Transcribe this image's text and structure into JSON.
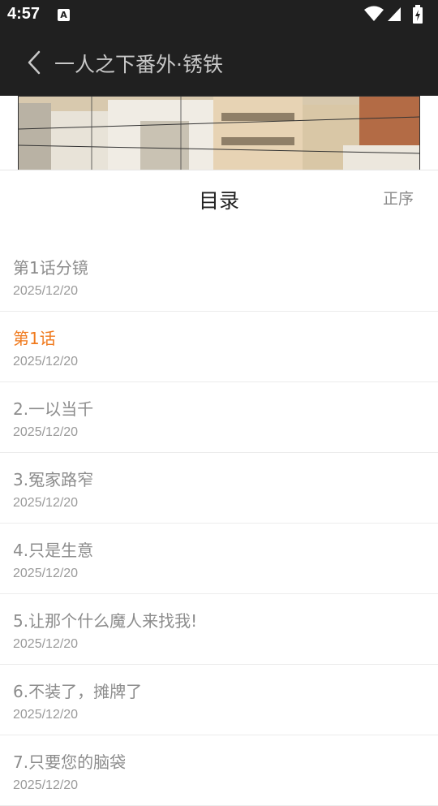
{
  "status_bar": {
    "time": "4:57",
    "icons": [
      "a-notification-icon",
      "wifi-icon",
      "signal-icon",
      "battery-charging-icon"
    ]
  },
  "app_bar": {
    "title": "一人之下番外·锈铁"
  },
  "sheet": {
    "title": "目录",
    "sort_label": "正序"
  },
  "chapters": [
    {
      "name": "第1话分镜",
      "date": "2025/12/20",
      "active": false
    },
    {
      "name": "第1话",
      "date": "2025/12/20",
      "active": true
    },
    {
      "name": "2.一以当千",
      "date": "2025/12/20",
      "active": false
    },
    {
      "name": "3.冤家路窄",
      "date": "2025/12/20",
      "active": false
    },
    {
      "name": "4.只是生意",
      "date": "2025/12/20",
      "active": false
    },
    {
      "name": "5.让那个什么魔人来找我!",
      "date": "2025/12/20",
      "active": false
    },
    {
      "name": "6.不装了，摊牌了",
      "date": "2025/12/20",
      "active": false
    },
    {
      "name": "7.只要您的脑袋",
      "date": "2025/12/20",
      "active": false
    }
  ],
  "colors": {
    "bar_background": "#202020",
    "active_chapter": "#f07a1e",
    "inactive_text": "#8c8c8c"
  }
}
